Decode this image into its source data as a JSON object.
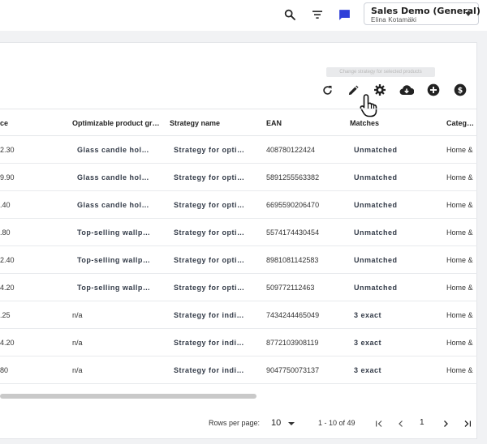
{
  "topbar": {
    "icons": [
      "search-icon",
      "filter-icon",
      "chat-icon"
    ],
    "account": {
      "name": "Sales Demo (General)",
      "user": "Elina Kotamäki"
    },
    "accent": "#2f3fd8"
  },
  "toolbar": {
    "tooltip": "Change strategy for selected products",
    "icons": [
      "refresh-icon",
      "edit-icon",
      "settings-icon",
      "cloud-download-icon",
      "add-circle-icon",
      "dollar-circle-icon"
    ]
  },
  "table": {
    "columns": [
      "ce",
      "Optimizable product group",
      "Strategy name",
      "EAN",
      "Matches",
      "Category"
    ],
    "rows": [
      {
        "price": "2.30",
        "group": "Glass candle holder",
        "strategy": "Strategy for optimizing",
        "ean": "408780122424",
        "matches": "Unmatched",
        "category": "Home &"
      },
      {
        "price": "9.90",
        "group": "Glass candle holder",
        "strategy": "Strategy for optimizing",
        "ean": "5891255563382",
        "matches": "Unmatched",
        "category": "Home &"
      },
      {
        "price": ".40",
        "group": "Glass candle holder",
        "strategy": "Strategy for optimizing",
        "ean": "6695590206470",
        "matches": "Unmatched",
        "category": "Home &"
      },
      {
        "price": ".80",
        "group": "Top-selling wallpapers",
        "strategy": "Strategy for optimizing",
        "ean": "5574174430454",
        "matches": "Unmatched",
        "category": "Home &"
      },
      {
        "price": "2.40",
        "group": "Top-selling wallpapers",
        "strategy": "Strategy for optimizing",
        "ean": "8981081142583",
        "matches": "Unmatched",
        "category": "Home &"
      },
      {
        "price": "4.20",
        "group": "Top-selling wallpapers",
        "strategy": "Strategy for optimizing",
        "ean": "509772112463",
        "matches": "Unmatched",
        "category": "Home &"
      },
      {
        "price": ".25",
        "group": "n/a",
        "strategy": "Strategy for individual",
        "ean": "7434244465049",
        "matches": "3 exact",
        "category": "Home &"
      },
      {
        "price": "4.20",
        "group": "n/a",
        "strategy": "Strategy for individual",
        "ean": "8772103908119",
        "matches": "3 exact",
        "category": "Home &"
      },
      {
        "price": "80",
        "group": "n/a",
        "strategy": "Strategy for individual",
        "ean": "9047750073137",
        "matches": "3 exact",
        "category": "Home &"
      }
    ]
  },
  "pagination": {
    "rows_per_page_label": "Rows per page:",
    "rows_per_page": "10",
    "range": "1 - 10 of 49",
    "current_page": "1"
  }
}
